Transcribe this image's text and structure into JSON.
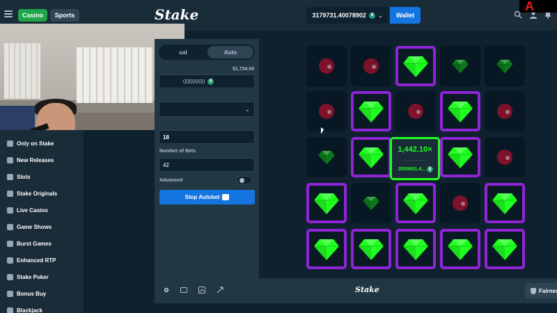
{
  "topbar": {
    "casino_label": "Casino",
    "sports_label": "Sports",
    "logo_text": "Stake",
    "balance": "3179731.40078902",
    "currency_icon": "tether-icon",
    "wallet_label": "Wallet",
    "corner_text": "A"
  },
  "sidebar": {
    "items": [
      {
        "label": "Only on Stake",
        "icon": "stake-icon"
      },
      {
        "label": "New Releases",
        "icon": "sparkle-icon"
      },
      {
        "label": "Slots",
        "icon": "slots-icon"
      },
      {
        "label": "Stake Originals",
        "icon": "flame-icon"
      },
      {
        "label": "Live Casino",
        "icon": "live-icon"
      },
      {
        "label": "Game Shows",
        "icon": "mic-icon"
      },
      {
        "label": "Burst Games",
        "icon": "burst-icon"
      },
      {
        "label": "Enhanced RTP",
        "icon": "chart-icon"
      },
      {
        "label": "Stake Poker",
        "icon": "cards-icon"
      },
      {
        "label": "Bonus Buy",
        "icon": "gift-icon"
      },
      {
        "label": "Blackjack",
        "icon": "blackjack-icon"
      }
    ]
  },
  "panel": {
    "tab_manual": "ual",
    "tab_auto": "Auto",
    "amount_usd": "$1,734.00",
    "amount_value": "0000000",
    "mines_label": "",
    "mines_value": "18",
    "bets_label": "Number of Bets",
    "bets_value": "42",
    "advanced_label": "Advanced",
    "stop_button": "Stop Autobet"
  },
  "game": {
    "multiplier": "1,442.10×",
    "win_amount": "2500601.4...",
    "grid": [
      [
        "mine",
        "mine",
        "gem-selected",
        "gem",
        "gem"
      ],
      [
        "mine",
        "gem-selected",
        "mine",
        "gem-selected",
        "mine"
      ],
      [
        "gem",
        "gem-selected",
        "center",
        "gem-selected",
        "mine"
      ],
      [
        "gem-selected",
        "gem",
        "gem-selected",
        "mine",
        "gem-selected"
      ],
      [
        "gem-selected",
        "gem-selected",
        "gem-selected",
        "gem-selected",
        "gem-selected"
      ]
    ],
    "colors": {
      "gem_bright": "#1fff20",
      "gem_dim": "#0b7a1a",
      "selected_border": "#8f25d6",
      "mine": "#a8102e"
    }
  },
  "bottombar": {
    "logo_text": "Stake",
    "fairness_label": "Fairnes"
  }
}
